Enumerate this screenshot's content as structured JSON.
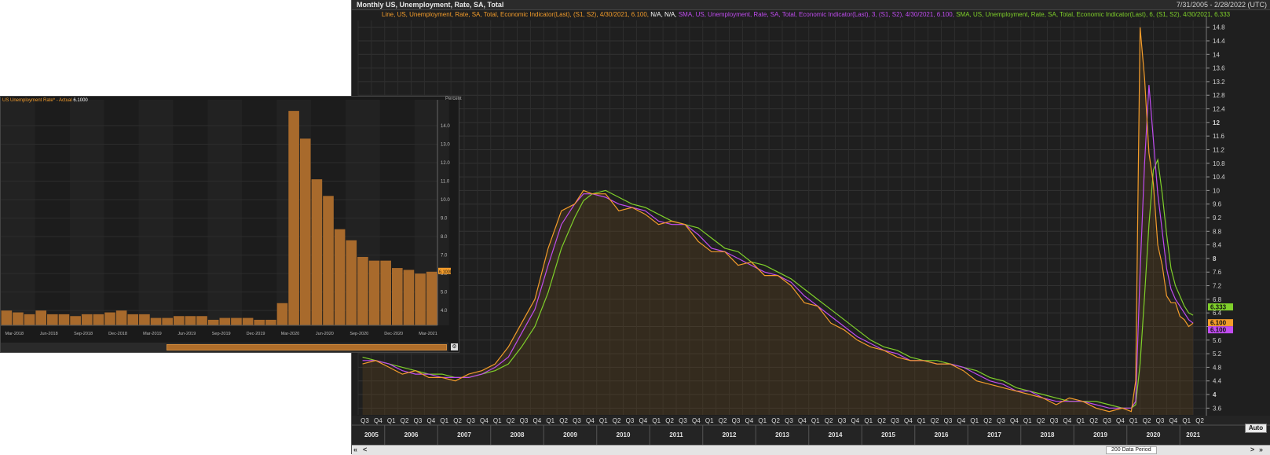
{
  "main": {
    "title": "Monthly US, Unemployment, Rate, SA, Total",
    "range": "7/31/2005 - 2/28/2022 (UTC)",
    "legend": {
      "line_orange": "Line, US, Unemployment, Rate, SA, Total, Economic Indicator(Last), (S1, S2), 4/30/2021, 6.100,",
      "na_white": "N/A, N/A,",
      "sma3_purple": "SMA, US, Unemployment, Rate, SA, Total, Economic Indicator(Last), 3, (S1, S2), 4/30/2021, 6.100,",
      "sma6_green": "SMA, US, Unemployment, Rate, SA, Total, Economic Indicator(Last), 6, (S1, S2), 4/30/2021, 6.333"
    },
    "last_labels": {
      "green": "6.333",
      "orange": "6.100",
      "purple": "6.100"
    },
    "auto_label": "Auto",
    "period_label": "200 Data Period",
    "nav": {
      "first": "«",
      "prev": "<",
      "next": ">",
      "last": "»"
    },
    "colors": {
      "orange": "#f39c2b",
      "purple": "#c04cf0",
      "green": "#7fd02a",
      "bg": "#1f1f1f",
      "grid": "#333333"
    }
  },
  "inset": {
    "legend_label": "US Unemployment Rate* - Actual",
    "legend_value": "6.1000",
    "unit": "Percent",
    "last_value_label": "6.1000"
  },
  "chart_data": [
    {
      "type": "line",
      "title": "Monthly US, Unemployment, Rate, SA, Total",
      "xlabel": "",
      "ylabel": "",
      "x_range": [
        "2005-07-31",
        "2022-02-28"
      ],
      "ylim": [
        3.4,
        15.0
      ],
      "y_ticks": [
        3.6,
        4,
        4.4,
        4.8,
        5.2,
        5.6,
        6,
        6.4,
        6.8,
        7.2,
        7.6,
        8,
        8.4,
        8.8,
        9.2,
        9.6,
        10,
        10.4,
        10.8,
        11.2,
        11.6,
        12,
        12.4,
        12.8,
        13.2,
        13.6,
        14,
        14.4,
        14.8
      ],
      "years": [
        "2005",
        "2006",
        "2007",
        "2008",
        "2009",
        "2010",
        "2011",
        "2012",
        "2013",
        "2014",
        "2015",
        "2016",
        "2017",
        "2018",
        "2019",
        "2020",
        "2021"
      ],
      "start_year": 2005,
      "start_quarter": 3,
      "end_year": 2021,
      "end_quarter": 2,
      "grid": true,
      "legend": "top-left",
      "series": [
        {
          "name": "Line, US, Unemployment, Rate, SA, Total, Economic Indicator(Last), (S1, S2)",
          "color": "#f39c2b",
          "dates": [
            "2005-08",
            "2005-11",
            "2006-02",
            "2006-05",
            "2006-08",
            "2006-11",
            "2007-02",
            "2007-05",
            "2007-08",
            "2007-11",
            "2008-02",
            "2008-05",
            "2008-08",
            "2008-11",
            "2009-02",
            "2009-05",
            "2009-08",
            "2009-10",
            "2009-12",
            "2010-03",
            "2010-06",
            "2010-09",
            "2010-12",
            "2011-03",
            "2011-06",
            "2011-09",
            "2011-12",
            "2012-03",
            "2012-06",
            "2012-09",
            "2012-12",
            "2013-03",
            "2013-06",
            "2013-09",
            "2013-12",
            "2014-03",
            "2014-06",
            "2014-09",
            "2014-12",
            "2015-03",
            "2015-06",
            "2015-09",
            "2015-12",
            "2016-03",
            "2016-06",
            "2016-09",
            "2016-12",
            "2017-03",
            "2017-06",
            "2017-09",
            "2017-12",
            "2018-03",
            "2018-06",
            "2018-09",
            "2018-12",
            "2019-03",
            "2019-06",
            "2019-09",
            "2019-12",
            "2020-02",
            "2020-03",
            "2020-04",
            "2020-05",
            "2020-06",
            "2020-07",
            "2020-08",
            "2020-09",
            "2020-10",
            "2020-11",
            "2020-12",
            "2021-01",
            "2021-02",
            "2021-03",
            "2021-04"
          ],
          "values": [
            4.9,
            5.0,
            4.8,
            4.6,
            4.7,
            4.5,
            4.5,
            4.4,
            4.6,
            4.7,
            4.9,
            5.4,
            6.1,
            6.8,
            8.3,
            9.4,
            9.6,
            10.0,
            9.9,
            9.9,
            9.4,
            9.5,
            9.3,
            9.0,
            9.1,
            9.0,
            8.5,
            8.2,
            8.2,
            7.8,
            7.9,
            7.5,
            7.5,
            7.2,
            6.7,
            6.6,
            6.1,
            5.9,
            5.6,
            5.4,
            5.3,
            5.1,
            5.0,
            5.0,
            4.9,
            4.9,
            4.7,
            4.4,
            4.3,
            4.2,
            4.1,
            4.0,
            3.9,
            3.7,
            3.9,
            3.8,
            3.6,
            3.5,
            3.6,
            3.5,
            4.4,
            14.8,
            13.3,
            11.1,
            10.2,
            8.4,
            7.8,
            6.9,
            6.7,
            6.7,
            6.3,
            6.2,
            6.0,
            6.1
          ]
        },
        {
          "name": "SMA, US, Unemployment, Rate, SA, Total, Economic Indicator(Last), 3, (S1, S2)",
          "color": "#c04cf0",
          "dates": [
            "2005-08",
            "2005-11",
            "2006-02",
            "2006-05",
            "2006-08",
            "2006-11",
            "2007-02",
            "2007-05",
            "2007-08",
            "2007-11",
            "2008-02",
            "2008-05",
            "2008-08",
            "2008-11",
            "2009-02",
            "2009-05",
            "2009-08",
            "2009-10",
            "2009-12",
            "2010-03",
            "2010-06",
            "2010-09",
            "2010-12",
            "2011-03",
            "2011-06",
            "2011-09",
            "2011-12",
            "2012-03",
            "2012-06",
            "2012-09",
            "2012-12",
            "2013-03",
            "2013-06",
            "2013-09",
            "2013-12",
            "2014-03",
            "2014-06",
            "2014-09",
            "2014-12",
            "2015-03",
            "2015-06",
            "2015-09",
            "2015-12",
            "2016-03",
            "2016-06",
            "2016-09",
            "2016-12",
            "2017-03",
            "2017-06",
            "2017-09",
            "2017-12",
            "2018-03",
            "2018-06",
            "2018-09",
            "2018-12",
            "2019-03",
            "2019-06",
            "2019-09",
            "2019-12",
            "2020-02",
            "2020-03",
            "2020-04",
            "2020-05",
            "2020-06",
            "2020-07",
            "2020-08",
            "2020-09",
            "2020-10",
            "2020-11",
            "2020-12",
            "2021-01",
            "2021-02",
            "2021-03",
            "2021-04"
          ],
          "values": [
            5.0,
            5.0,
            4.9,
            4.7,
            4.6,
            4.6,
            4.5,
            4.5,
            4.5,
            4.6,
            4.8,
            5.1,
            5.8,
            6.5,
            7.8,
            9.0,
            9.6,
            9.9,
            9.9,
            9.8,
            9.6,
            9.5,
            9.4,
            9.1,
            9.0,
            9.0,
            8.7,
            8.3,
            8.2,
            8.0,
            7.8,
            7.6,
            7.5,
            7.3,
            6.9,
            6.6,
            6.3,
            6.0,
            5.7,
            5.5,
            5.3,
            5.2,
            5.0,
            5.0,
            4.9,
            4.9,
            4.8,
            4.6,
            4.4,
            4.3,
            4.1,
            4.1,
            3.9,
            3.8,
            3.8,
            3.8,
            3.7,
            3.6,
            3.6,
            3.6,
            3.8,
            7.6,
            10.8,
            13.1,
            11.5,
            9.9,
            8.8,
            7.7,
            7.1,
            6.8,
            6.6,
            6.4,
            6.2,
            6.1
          ]
        },
        {
          "name": "SMA, US, Unemployment, Rate, SA, Total, Economic Indicator(Last), 6, (S1, S2)",
          "color": "#7fd02a",
          "dates": [
            "2005-08",
            "2005-11",
            "2006-02",
            "2006-05",
            "2006-08",
            "2006-11",
            "2007-02",
            "2007-05",
            "2007-08",
            "2007-11",
            "2008-02",
            "2008-05",
            "2008-08",
            "2008-11",
            "2009-02",
            "2009-05",
            "2009-08",
            "2009-10",
            "2009-12",
            "2010-03",
            "2010-06",
            "2010-09",
            "2010-12",
            "2011-03",
            "2011-06",
            "2011-09",
            "2011-12",
            "2012-03",
            "2012-06",
            "2012-09",
            "2012-12",
            "2013-03",
            "2013-06",
            "2013-09",
            "2013-12",
            "2014-03",
            "2014-06",
            "2014-09",
            "2014-12",
            "2015-03",
            "2015-06",
            "2015-09",
            "2015-12",
            "2016-03",
            "2016-06",
            "2016-09",
            "2016-12",
            "2017-03",
            "2017-06",
            "2017-09",
            "2017-12",
            "2018-03",
            "2018-06",
            "2018-09",
            "2018-12",
            "2019-03",
            "2019-06",
            "2019-09",
            "2019-12",
            "2020-02",
            "2020-03",
            "2020-04",
            "2020-05",
            "2020-06",
            "2020-07",
            "2020-08",
            "2020-09",
            "2020-10",
            "2020-11",
            "2020-12",
            "2021-01",
            "2021-02",
            "2021-03",
            "2021-04"
          ],
          "values": [
            5.1,
            5.0,
            4.9,
            4.8,
            4.7,
            4.6,
            4.6,
            4.5,
            4.5,
            4.6,
            4.7,
            4.9,
            5.4,
            6.0,
            7.0,
            8.3,
            9.2,
            9.7,
            9.9,
            10.0,
            9.8,
            9.6,
            9.5,
            9.3,
            9.1,
            9.0,
            8.9,
            8.6,
            8.3,
            8.2,
            7.9,
            7.8,
            7.6,
            7.4,
            7.1,
            6.8,
            6.5,
            6.2,
            5.9,
            5.6,
            5.4,
            5.3,
            5.1,
            5.0,
            5.0,
            4.9,
            4.8,
            4.7,
            4.5,
            4.4,
            4.2,
            4.1,
            4.0,
            3.9,
            3.8,
            3.8,
            3.8,
            3.7,
            3.6,
            3.6,
            3.7,
            4.9,
            6.9,
            9.0,
            10.6,
            10.9,
            9.9,
            8.7,
            7.7,
            7.2,
            6.9,
            6.6,
            6.4,
            6.333
          ]
        }
      ]
    },
    {
      "type": "bar",
      "title": "",
      "xlabel": "",
      "ylabel": "Percent",
      "ylim": [
        3.2,
        15.4
      ],
      "y_ticks": [
        4.0,
        5.0,
        6.0,
        7.0,
        8.0,
        9.0,
        10.0,
        11.0,
        12.0,
        13.0,
        14.0
      ],
      "x_tick_labels": [
        "Mar-2018",
        "Jun-2018",
        "Sep-2018",
        "Dec-2018",
        "Mar-2019",
        "Jun-2019",
        "Sep-2019",
        "Dec-2019",
        "Mar-2020",
        "Jun-2020",
        "Sep-2020",
        "Dec-2020",
        "Mar-2021"
      ],
      "legend": "top-left",
      "series": [
        {
          "name": "US Unemployment Rate* - Actual",
          "color": "#a86a2c",
          "categories": [
            "2018-03",
            "2018-04",
            "2018-05",
            "2018-06",
            "2018-07",
            "2018-08",
            "2018-09",
            "2018-10",
            "2018-11",
            "2018-12",
            "2019-01",
            "2019-02",
            "2019-03",
            "2019-04",
            "2019-05",
            "2019-06",
            "2019-07",
            "2019-08",
            "2019-09",
            "2019-10",
            "2019-11",
            "2019-12",
            "2020-01",
            "2020-02",
            "2020-03",
            "2020-04",
            "2020-05",
            "2020-06",
            "2020-07",
            "2020-08",
            "2020-09",
            "2020-10",
            "2020-11",
            "2020-12",
            "2021-01",
            "2021-02",
            "2021-03",
            "2021-04"
          ],
          "values": [
            4.0,
            3.9,
            3.8,
            4.0,
            3.8,
            3.8,
            3.7,
            3.8,
            3.8,
            3.9,
            4.0,
            3.8,
            3.8,
            3.6,
            3.6,
            3.7,
            3.7,
            3.7,
            3.5,
            3.6,
            3.6,
            3.6,
            3.5,
            3.5,
            4.4,
            14.8,
            13.3,
            11.1,
            10.2,
            8.4,
            7.8,
            6.9,
            6.7,
            6.7,
            6.3,
            6.2,
            6.0,
            6.1
          ]
        }
      ]
    }
  ]
}
